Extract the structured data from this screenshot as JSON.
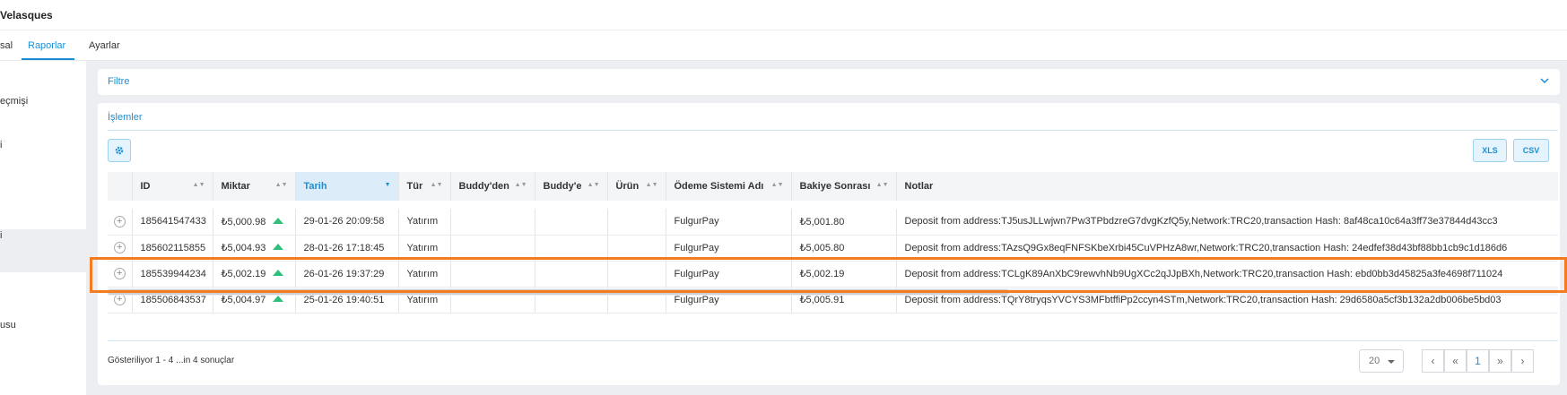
{
  "header": {
    "title": "Velasques"
  },
  "tabs": [
    {
      "label": "sal"
    },
    {
      "label": "Raporlar"
    },
    {
      "label": "Ayarlar"
    }
  ],
  "sidebar": {
    "items": [
      {
        "label": "eçmişi"
      },
      {
        "label": "i"
      },
      {
        "label": "i"
      },
      {
        "label": "usu"
      }
    ]
  },
  "filter": {
    "label": "Filtre"
  },
  "transactions": {
    "heading": "İşlemler",
    "export_xls": "XLS",
    "export_csv": "CSV",
    "columns": [
      "ID",
      "Miktar",
      "Tarih",
      "Tür",
      "Buddy'den",
      "Buddy'e",
      "Ürün",
      "Ödeme Sistemi Adı",
      "Bakiye Sonrası",
      "Notlar"
    ],
    "sorted_column": "Tarih",
    "rows": [
      {
        "id": "185641547433",
        "amount": "₺5,000.98",
        "date": "29-01-26 20:09:58",
        "type": "Yatırım",
        "buddy_from": "",
        "buddy_to": "",
        "product": "",
        "payment_system": "FulgurPay",
        "balance_after": "₺5,001.80",
        "notes": "Deposit from address:TJ5usJLLwjwn7Pw3TPbdzreG7dvgKzfQ5y,Network:TRC20,transaction Hash: 8af48ca10c64a3ff73e37844d43cc3"
      },
      {
        "id": "185602115855",
        "amount": "₺5,004.93",
        "date": "28-01-26 17:18:45",
        "type": "Yatırım",
        "buddy_from": "",
        "buddy_to": "",
        "product": "",
        "payment_system": "FulgurPay",
        "balance_after": "₺5,005.80",
        "notes": "Deposit from address:TAzsQ9Gx8eqFNFSKbeXrbi45CuVPHzA8wr,Network:TRC20,transaction Hash: 24edfef38d43bf88bb1cb9c1d186d6"
      },
      {
        "id": "185539944234",
        "amount": "₺5,002.19",
        "date": "26-01-26 19:37:29",
        "type": "Yatırım",
        "buddy_from": "",
        "buddy_to": "",
        "product": "",
        "payment_system": "FulgurPay",
        "balance_after": "₺5,002.19",
        "notes": "Deposit from address:TCLgK89AnXbC9rewvhNb9UgXCc2qJJpBXh,Network:TRC20,transaction Hash: ebd0bb3d45825a3fe4698f711024"
      },
      {
        "id": "185506843537",
        "amount": "₺5,004.97",
        "date": "25-01-26 19:40:51",
        "type": "Yatırım",
        "buddy_from": "",
        "buddy_to": "",
        "product": "",
        "payment_system": "FulgurPay",
        "balance_after": "₺5,005.91",
        "notes": "Deposit from address:TQrY8tryqsYVCYS3MFbtffiPp2ccyn4STm,Network:TRC20,transaction Hash: 29d6580a5cf3b132a2db006be5bd03"
      }
    ]
  },
  "pagination": {
    "summary": "Gösteriliyor 1 - 4 ...in 4 sonuçlar",
    "page_size": "20",
    "current_page": "1"
  },
  "colors": {
    "accent": "#1b8fd4",
    "highlight": "#f47b20",
    "up_arrow": "#2fbf7a"
  }
}
